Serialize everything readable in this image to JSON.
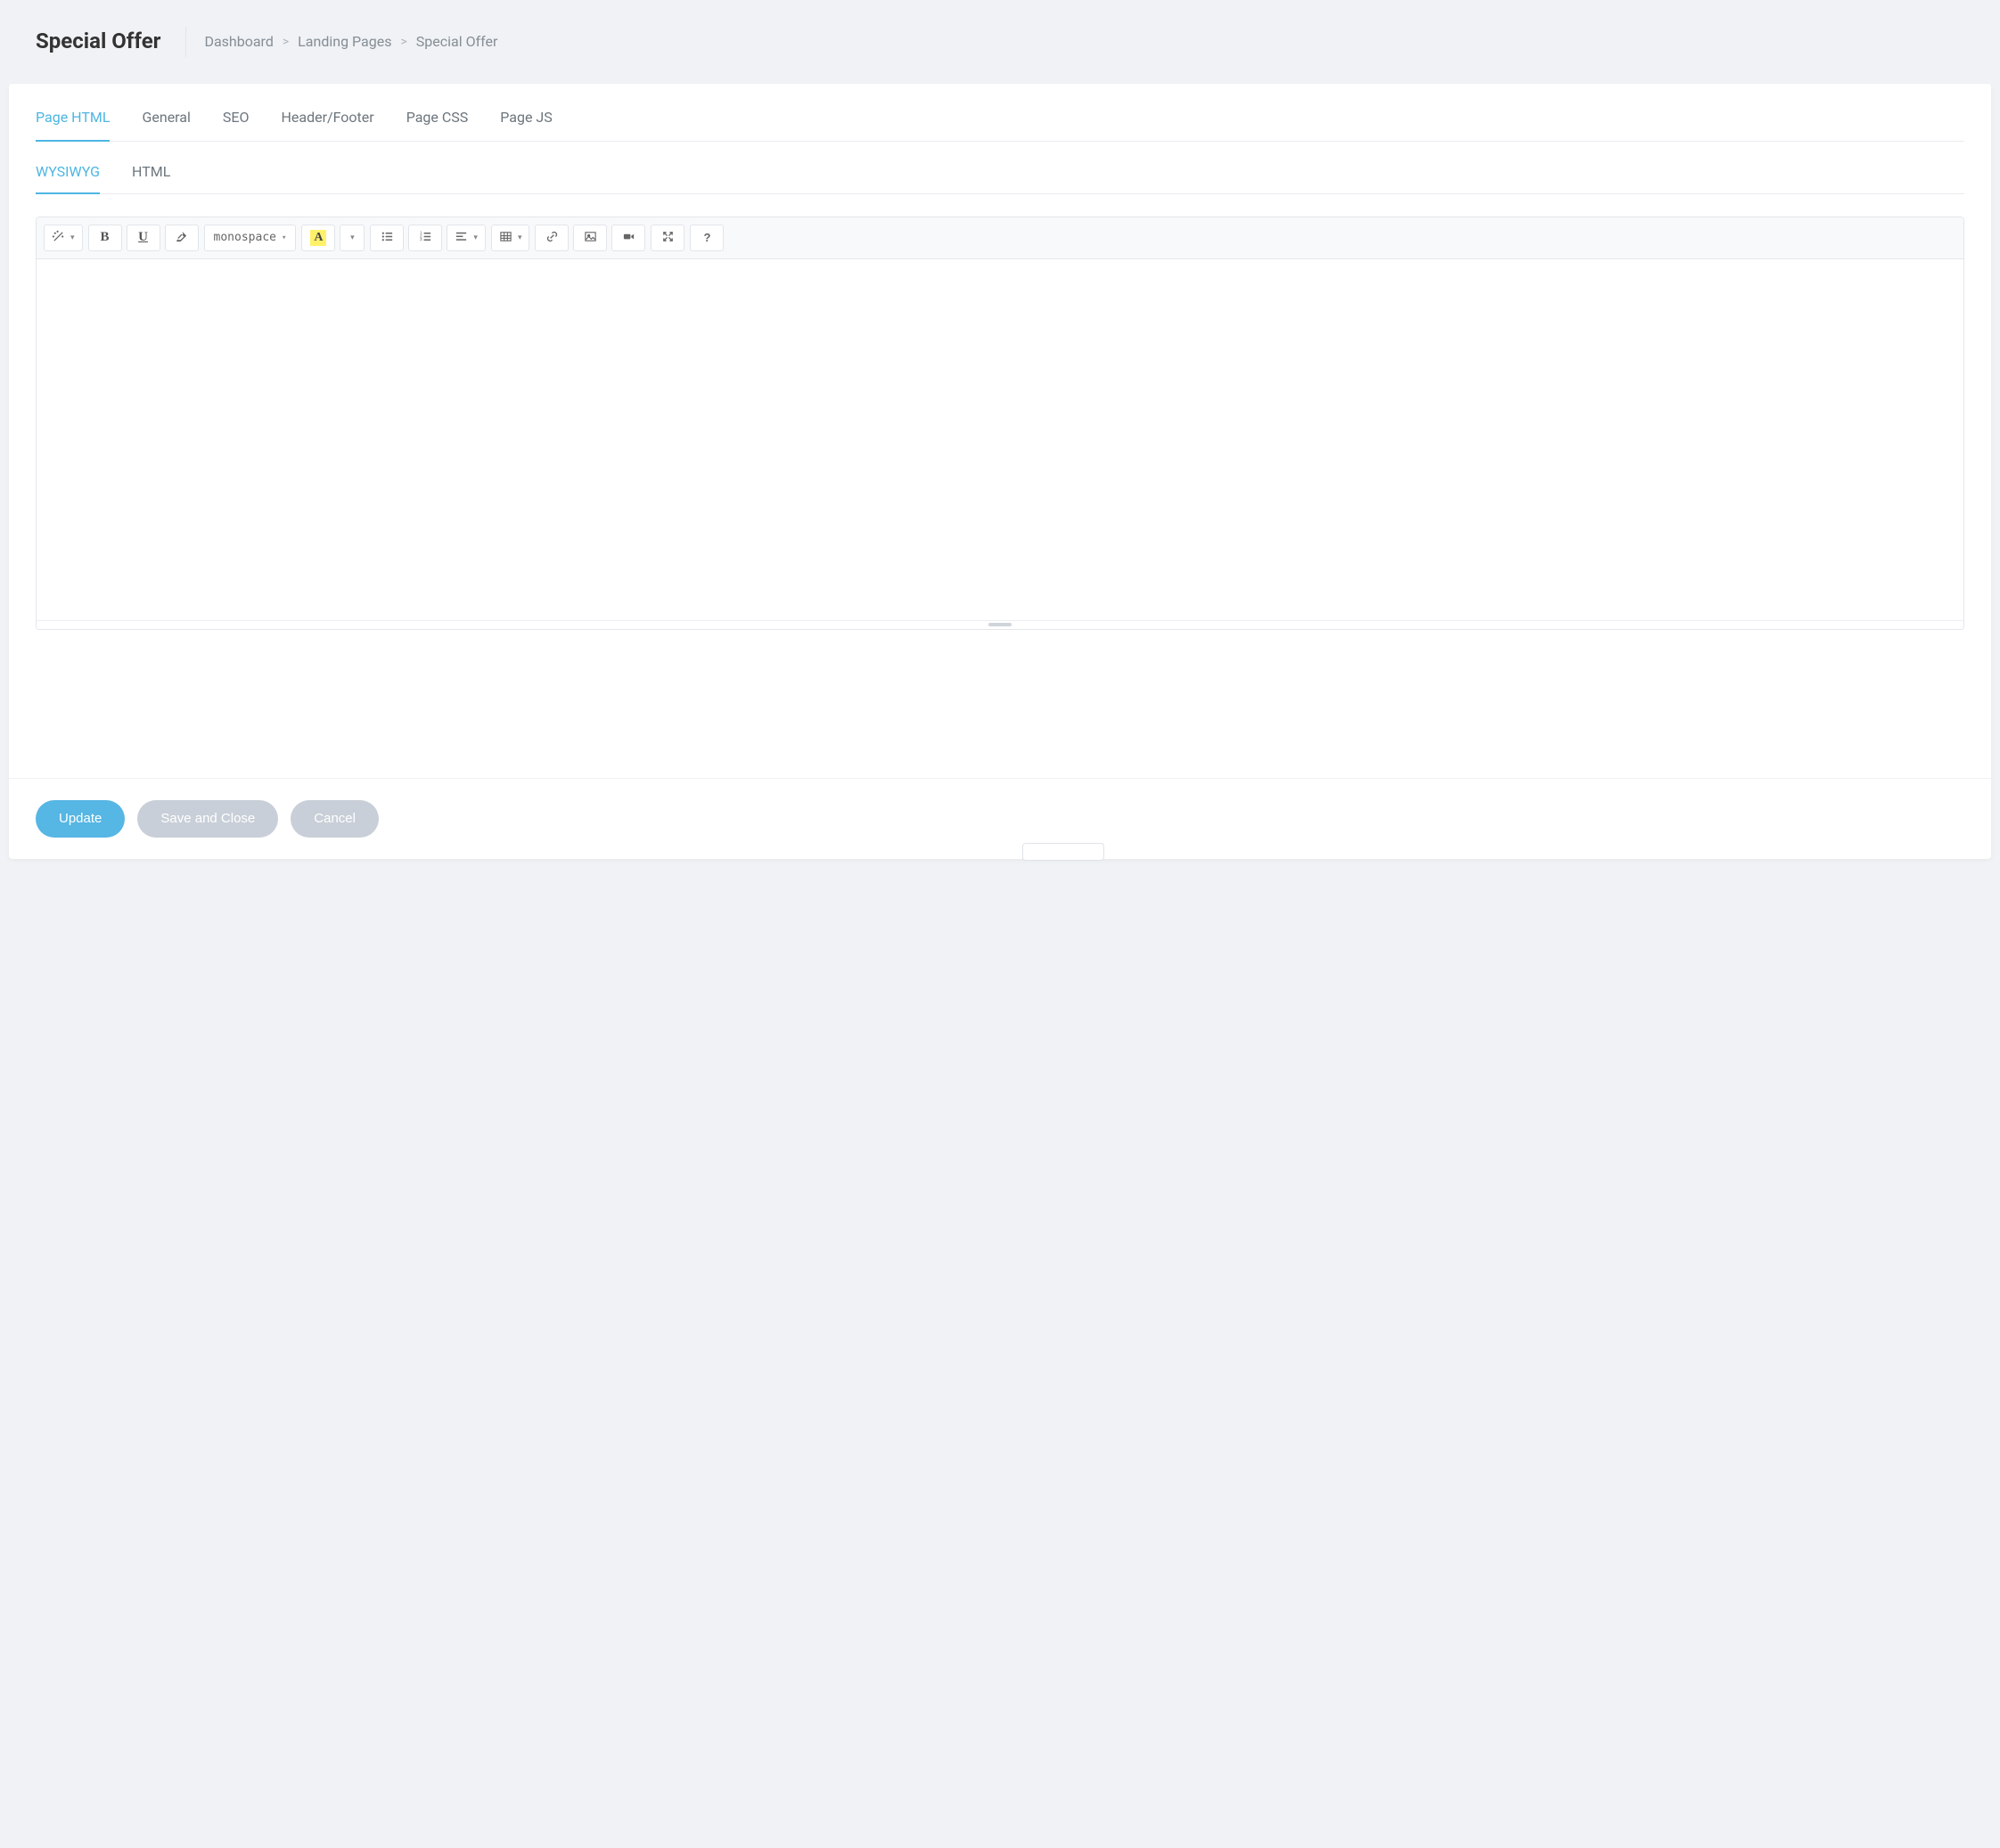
{
  "header": {
    "title": "Special Offer",
    "breadcrumbs": [
      "Dashboard",
      "Landing Pages",
      "Special Offer"
    ]
  },
  "tabs": {
    "items": [
      "Page HTML",
      "General",
      "SEO",
      "Header/Footer",
      "Page CSS",
      "Page JS"
    ],
    "active_index": 0
  },
  "subtabs": {
    "items": [
      "WYSIWYG",
      "HTML"
    ],
    "active_index": 0
  },
  "editor": {
    "font_family_label": "monospace",
    "content": ""
  },
  "toolbar_icons": {
    "style": "magic-wand-icon",
    "bold": "B",
    "underline": "U",
    "clear": "eraser-icon",
    "fontname": "monospace",
    "color": "A",
    "ul": "list-ul-icon",
    "ol": "list-ol-icon",
    "paragraph": "align-left-icon",
    "table": "table-icon",
    "link": "link-icon",
    "picture": "image-icon",
    "video": "video-icon",
    "fullscreen": "fullscreen-icon",
    "help": "?"
  },
  "footer": {
    "update": "Update",
    "save_close": "Save and Close",
    "cancel": "Cancel"
  }
}
